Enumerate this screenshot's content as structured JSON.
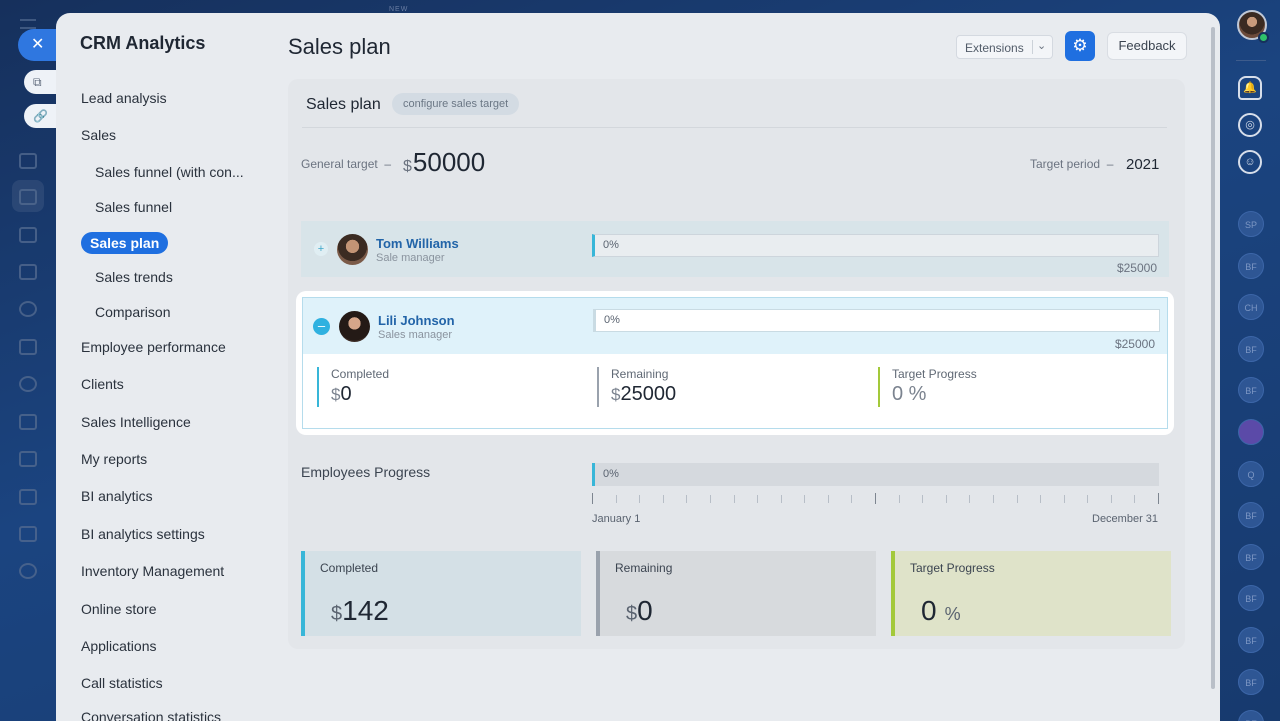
{
  "background_app": {
    "new_tag": "NEW",
    "close_symbol": "✕",
    "right_rail_avatars": [
      "SP",
      "BF",
      "CH",
      "BF",
      "BF",
      "",
      "Q",
      "BF",
      "BF",
      "BF",
      "BF",
      "BF",
      "BF"
    ]
  },
  "sidebar": {
    "title": "CRM Analytics",
    "items": [
      {
        "label": "Lead analysis",
        "level": 0
      },
      {
        "label": "Sales",
        "level": 0
      },
      {
        "label": "Sales funnel (with con...",
        "level": 1
      },
      {
        "label": "Sales funnel",
        "level": 1
      },
      {
        "label": "Sales plan",
        "level": 1,
        "active": true
      },
      {
        "label": "Sales trends",
        "level": 1
      },
      {
        "label": "Comparison",
        "level": 1
      },
      {
        "label": "Employee performance",
        "level": 0
      },
      {
        "label": "Clients",
        "level": 0
      },
      {
        "label": "Sales Intelligence",
        "level": 0
      },
      {
        "label": "My reports",
        "level": 0
      },
      {
        "label": "BI analytics",
        "level": 0
      },
      {
        "label": "BI analytics settings",
        "level": 0
      },
      {
        "label": "Inventory Management",
        "level": 0
      },
      {
        "label": "Online store",
        "level": 0
      },
      {
        "label": "Applications",
        "level": 0
      },
      {
        "label": "Call statistics",
        "level": 0
      },
      {
        "label": "Conversation statistics",
        "level": 0
      }
    ]
  },
  "header": {
    "title": "Sales plan",
    "extensions_label": "Extensions",
    "feedback_label": "Feedback"
  },
  "card": {
    "title": "Sales plan",
    "configure_label": "configure sales target",
    "general_target_label": "General target",
    "dash": "–",
    "currency": "$",
    "general_target_value": "50000",
    "target_period_label": "Target period",
    "target_period_value": "2021"
  },
  "employees": [
    {
      "name": "Tom Williams",
      "role": "Sale manager",
      "progress_label": "0%",
      "progress": 0,
      "target": "$25000",
      "expanded": false
    },
    {
      "name": "Lili Johnson",
      "role": "Sales manager",
      "progress_label": "0%",
      "progress": 0,
      "target": "$25000",
      "expanded": true,
      "stats": {
        "completed_label": "Completed",
        "completed_currency": "$",
        "completed_value": "0",
        "remaining_label": "Remaining",
        "remaining_currency": "$",
        "remaining_value": "25000",
        "progress_label": "Target Progress",
        "progress_value": "0 %"
      }
    }
  ],
  "employees_progress": {
    "label": "Employees Progress",
    "progress_label": "0%",
    "progress": 0,
    "start_label": "January 1",
    "end_label": "December 31"
  },
  "summary": {
    "completed_label": "Completed",
    "completed_currency": "$",
    "completed_value": "142",
    "remaining_label": "Remaining",
    "remaining_currency": "$",
    "remaining_value": "0",
    "progress_label": "Target Progress",
    "progress_value": "0",
    "progress_unit": "%"
  },
  "colors": {
    "accent": "#1f6fe0",
    "completed": "#38b6d8",
    "remaining": "#9aa2ad",
    "progress": "#a3c93a"
  }
}
